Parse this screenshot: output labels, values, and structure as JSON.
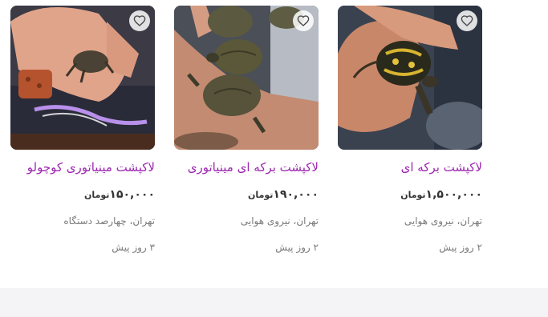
{
  "listings": [
    {
      "title": "لاکپشت برکه ای",
      "price": "۱,۵۰۰,۰۰۰",
      "currency": "تومان",
      "location": "تهران، نیروی هوایی",
      "time": "۲ روز پیش",
      "image": "turtle-in-hand-photo",
      "favorite_icon": "heart-icon"
    },
    {
      "title": "لاکپشت برکه ای مینیاتوری",
      "price": "۱۹۰,۰۰۰",
      "currency": "تومان",
      "location": "تهران، نیروی هوایی",
      "time": "۲ روز پیش",
      "image": "two-turtles-in-hand-photo",
      "favorite_icon": "heart-icon"
    },
    {
      "title": "لاکپشت مینیاتوری کوچولو",
      "price": "۱۵۰,۰۰۰",
      "currency": "تومان",
      "location": "تهران، چهارصد دستگاه",
      "time": "۳ روز پیش",
      "image": "tiny-turtle-on-palm-photo",
      "favorite_icon": "heart-icon"
    }
  ],
  "colors": {
    "title": "#9c27b0",
    "price": "#333333",
    "meta": "#7a7a7a",
    "footer_band": "#f4f4f7"
  }
}
